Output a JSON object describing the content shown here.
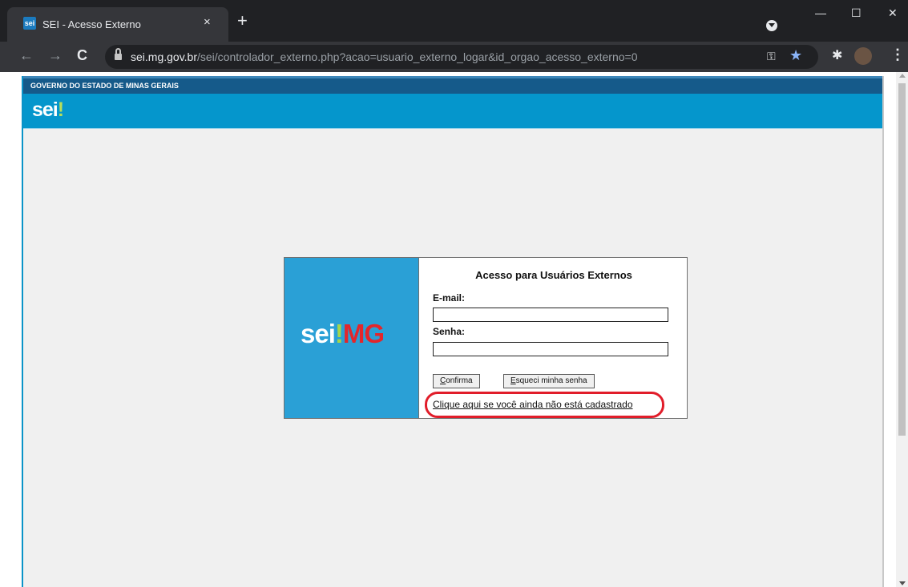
{
  "browser": {
    "tab": {
      "favicon_text": "sei",
      "title": "SEI - Acesso Externo",
      "close": "×"
    },
    "new_tab": "+",
    "window": {
      "minimize": "—",
      "maximize": "☐",
      "close": "✕"
    },
    "nav": {
      "back": "←",
      "forward": "→",
      "reload": "C"
    },
    "url_host": "sei.mg.gov.br",
    "url_path": "/sei/controlador_externo.php?acao=usuario_externo_logar&id_orgao_acesso_externo=0",
    "icons": {
      "key": "⚿",
      "star": "★",
      "extensions": "✱",
      "menu": "⋮"
    }
  },
  "site": {
    "gov_banner": "GOVERNO DO ESTADO DE MINAS GERAIS",
    "header_logo_text": "sei",
    "header_logo_mark": "!"
  },
  "login": {
    "logo": {
      "sei": "sei",
      "mark": "!",
      "mg": "MG"
    },
    "title": "Acesso para Usuários Externos",
    "email_label": "E-mail:",
    "email_value": "",
    "password_label": "Senha:",
    "password_value": "",
    "confirm_key": "C",
    "confirm_rest": "onfirma",
    "forgot_key": "E",
    "forgot_rest": "squeci minha senha",
    "register_link": "Clique aqui se você ainda não está cadastrado"
  },
  "colors": {
    "header_blue": "#0596cc",
    "gov_bar": "#155a8a",
    "logo_panel": "#2aa0d6",
    "highlight": "#e11d2a"
  }
}
